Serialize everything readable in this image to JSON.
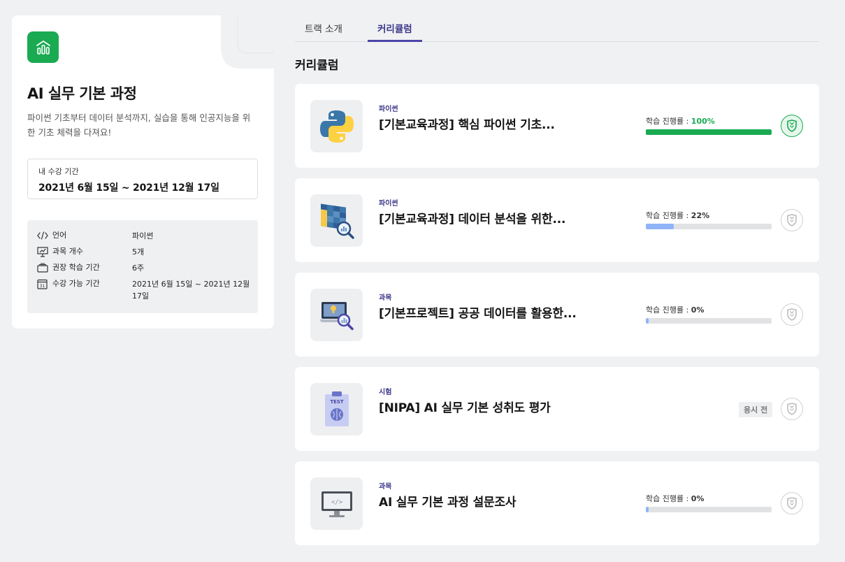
{
  "track": {
    "title": "AI 실무 기본 과정",
    "description": "파이썬 기초부터 데이터 분석까지, 실습을 통해 인공지능을 위한 기초 체력을 다져요!",
    "period_label": "내 수강 기간",
    "period_value": "2021년 6월 15일 ~ 2021년 12월 17일",
    "info": [
      {
        "icon": "code-icon",
        "label": "언어",
        "value": "파이썬"
      },
      {
        "icon": "presentation-icon",
        "label": "과목 개수",
        "value": "5개"
      },
      {
        "icon": "calendar-stack-icon",
        "label": "권장 학습 기간",
        "value": "6주"
      },
      {
        "icon": "calendar-31-icon",
        "label": "수강 가능 기간",
        "value": "2021년 6월 15일 ~ 2021년 12월 17일"
      }
    ]
  },
  "tabs": [
    {
      "label": "트랙 소개",
      "active": false
    },
    {
      "label": "커리큘럼",
      "active": true
    }
  ],
  "section_title": "커리큘럼",
  "progress_prefix": "학습 진행률 : ",
  "courses": [
    {
      "type": "파이썬",
      "title": "[기본교육과정] 핵심 파이썬 기초...",
      "progress_label": "100%",
      "progress": 100,
      "thumbnail": "python-logo-icon",
      "badge": "completed-shield-icon"
    },
    {
      "type": "파이썬",
      "title": "[기본교육과정] 데이터 분석을 위한...",
      "progress_label": "22%",
      "progress": 22,
      "thumbnail": "data-table-magnifier-icon",
      "badge": "shield-icon"
    },
    {
      "type": "과목",
      "title": "[기본프로젝트] 공공 데이터를 활용한...",
      "progress_label": "0%",
      "progress": 0,
      "thumbnail": "monitor-idea-magnifier-icon",
      "badge": "shield-icon"
    },
    {
      "type": "시험",
      "title": "[NIPA] AI 실무 기본 성취도 평가",
      "status": "응시 전",
      "thumbnail": "test-clipboard-icon",
      "badge": "shield-icon"
    },
    {
      "type": "과목",
      "title": "AI 실무 기본 과정 설문조사",
      "progress_label": "0%",
      "progress": 0,
      "thumbnail": "monitor-code-icon",
      "badge": "shield-icon"
    }
  ],
  "colors": {
    "accent": "#3c3889",
    "success": "#1aaa52",
    "progress_partial": "#8fb4f8",
    "progress_track": "#e1e2e4"
  }
}
